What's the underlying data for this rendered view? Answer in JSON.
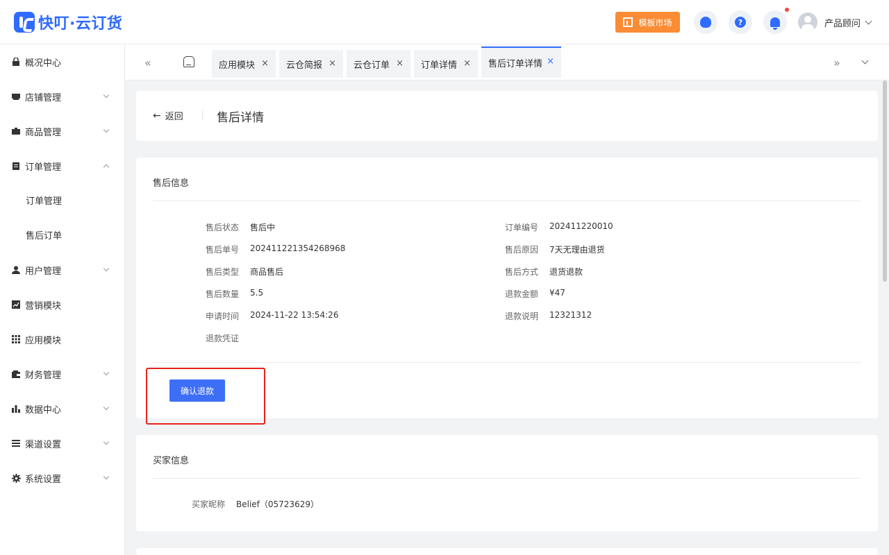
{
  "header": {
    "app_name": "快叮·云订货",
    "market_button": "模板市场",
    "help_glyph": "?",
    "user_name": "产品顾问"
  },
  "sidebar": {
    "items": [
      {
        "label": "概况中心",
        "icon": "lock-icon"
      },
      {
        "label": "店铺管理",
        "icon": "store-icon"
      },
      {
        "label": "商品管理",
        "icon": "briefcase-icon"
      },
      {
        "label": "订单管理",
        "icon": "clipboard-icon"
      },
      {
        "label": "订单管理",
        "icon": ""
      },
      {
        "label": "售后订单",
        "icon": ""
      },
      {
        "label": "用户管理",
        "icon": "user-icon"
      },
      {
        "label": "营销模块",
        "icon": "trend-icon"
      },
      {
        "label": "应用模块",
        "icon": "grid-icon"
      },
      {
        "label": "财务管理",
        "icon": "wallet-icon"
      },
      {
        "label": "数据中心",
        "icon": "bar-chart-icon"
      },
      {
        "label": "渠道设置",
        "icon": "list-icon"
      },
      {
        "label": "系统设置",
        "icon": "gear-icon"
      }
    ]
  },
  "tabs": {
    "left_arrow": "«",
    "right_arrow": "»",
    "close": "×",
    "items": [
      {
        "label": "应用模块"
      },
      {
        "label": "云仓简报"
      },
      {
        "label": "云仓订单"
      },
      {
        "label": "订单详情"
      },
      {
        "label": "售后订单详情"
      }
    ]
  },
  "page": {
    "back_arrow": "←",
    "back_label": "返回",
    "title": "售后详情"
  },
  "after_sales": {
    "section_title": "售后信息",
    "left_fields": [
      {
        "label": "售后状态",
        "value": "售后中"
      },
      {
        "label": "售后单号",
        "value": "202411221354268968"
      },
      {
        "label": "售后类型",
        "value": "商品售后"
      },
      {
        "label": "售后数量",
        "value": "5.5"
      },
      {
        "label": "申请时间",
        "value": "2024-11-22 13:54:26"
      },
      {
        "label": "退款凭证",
        "value": ""
      }
    ],
    "right_fields": [
      {
        "label": "订单编号",
        "value": "202411220010"
      },
      {
        "label": "售后原因",
        "value": "7天无理由退货"
      },
      {
        "label": "售后方式",
        "value": "退货退款"
      },
      {
        "label": "退款金额",
        "value": "¥47"
      },
      {
        "label": "退款说明",
        "value": "12321312"
      }
    ],
    "confirm_button": "确认退款"
  },
  "buyer": {
    "section_title": "买家信息",
    "nickname_label": "买家昵称",
    "nickname_value": "Belief（05723629）"
  },
  "colors": {
    "brand": "#2f6bff",
    "market": "#fa8c35",
    "button": "#3d6ff6",
    "highlight": "#e8211a"
  }
}
